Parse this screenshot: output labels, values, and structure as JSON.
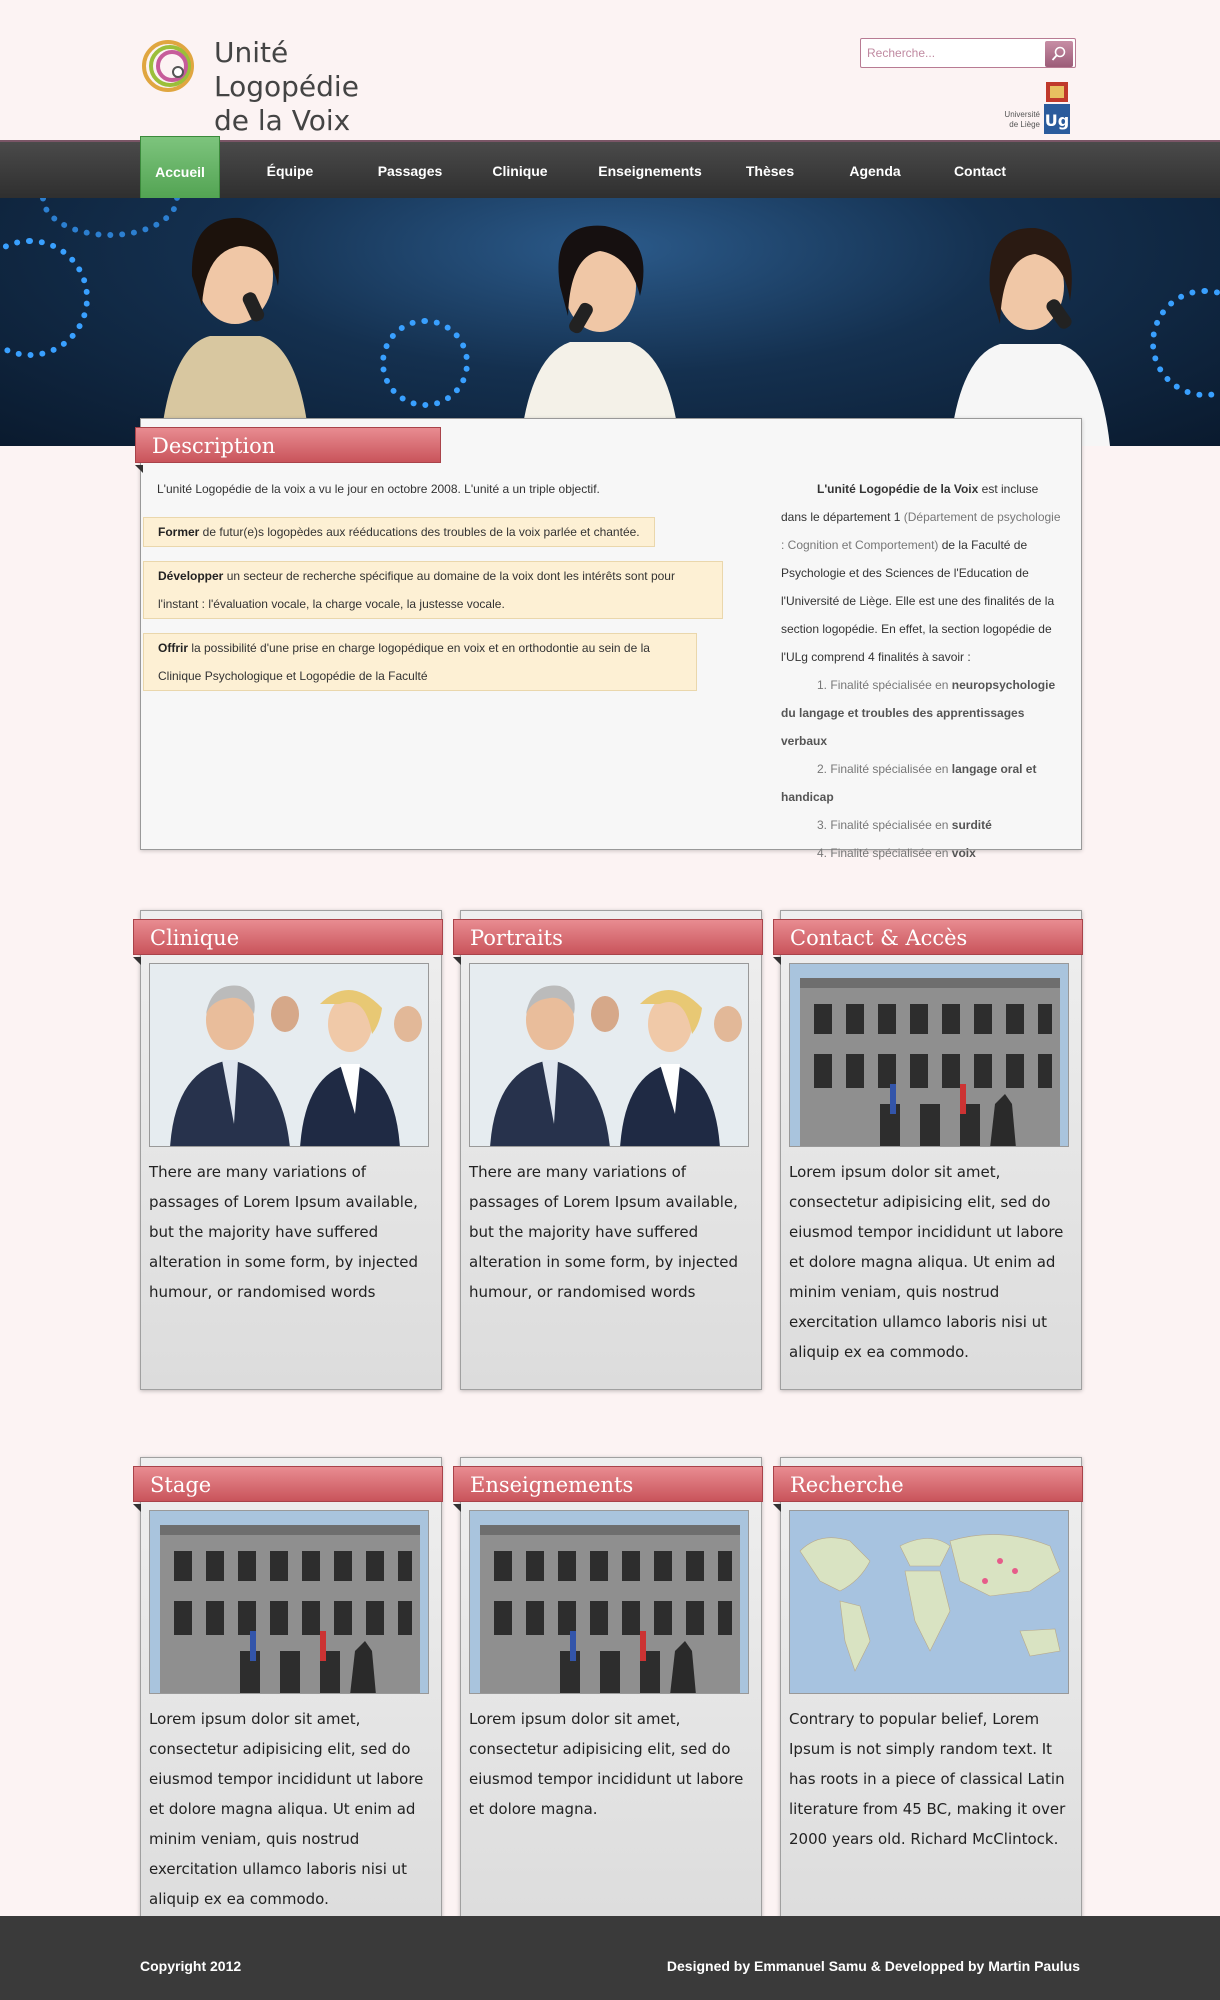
{
  "header": {
    "logo_line1": "Unité Logopédie",
    "logo_line2": "de la Voix",
    "search_placeholder": "Recherche...",
    "ulg_line1": "Université",
    "ulg_line2": "de Liège",
    "ulg_mark": "Ulg"
  },
  "nav": {
    "items": [
      "Accueil",
      "Équipe",
      "Passages",
      "Clinique",
      "Enseignements",
      "Thèses",
      "Agenda",
      "Contact"
    ],
    "active": "Accueil"
  },
  "description": {
    "title": "Description",
    "intro": "L'unité Logopédie de la voix a vu le jour en octobre 2008. L'unité a un triple objectif.",
    "objectives": [
      {
        "bold": "Former",
        "text": " de futur(e)s logopèdes aux rééducations des troubles de la voix parlée et chantée."
      },
      {
        "bold": "Développer",
        "text": " un secteur de recherche spécifique au domaine de la voix dont les intérêts sont pour l'instant : l'évaluation vocale, la charge vocale, la justesse vocale."
      },
      {
        "bold": "Offrir",
        "text": " la possibilité d'une prise en charge logopédique en voix et en orthodontie au sein de la Clinique Psychologique et Logopédie de la Faculté"
      }
    ],
    "side": {
      "bold_lead": "L'unité Logopédie de la Voix",
      "text1": " est incluse dans le département 1 ",
      "muted": "(Département de psychologie : Cognition et Comportement)",
      "text2": " de la Faculté de Psychologie et des Sciences de l'Education de l'Université de Liège. Elle est une des finalités de la section logopédie. En effet, la section logopédie de l'ULg comprend 4 finalités à savoir :",
      "list": [
        {
          "num": "1.",
          "pre": "Finalité spécialisée en ",
          "bold": "neuropsychologie du langage et troubles des apprentissages verbaux"
        },
        {
          "num": "2.",
          "pre": "Finalité spécialisée en ",
          "bold": "langage oral et handicap"
        },
        {
          "num": "3.",
          "pre": "Finalité spécialisée en ",
          "bold": "surdité"
        },
        {
          "num": "4.",
          "pre": "Finalité spécialisée en ",
          "bold": "voix"
        }
      ]
    }
  },
  "cards": [
    {
      "title": "Clinique",
      "image": "business-people",
      "text": "There are many variations of passages of Lorem Ipsum available, but the majority have suffered alteration in some form, by injected humour, or randomised words"
    },
    {
      "title": "Portraits",
      "image": "business-people",
      "text": "There are many variations of passages of Lorem Ipsum available, but the majority have suffered alteration in some form, by injected humour, or randomised words"
    },
    {
      "title": "Contact & Accès",
      "image": "university-building",
      "text": "Lorem ipsum dolor sit amet, consectetur adipisicing elit, sed do eiusmod tempor incididunt ut labore et dolore magna aliqua. Ut enim ad minim veniam, quis nostrud exercitation ullamco laboris nisi ut aliquip ex ea commodo."
    },
    {
      "title": "Stage",
      "image": "university-building",
      "text": "Lorem ipsum dolor sit amet, consectetur adipisicing elit, sed do eiusmod tempor incididunt ut labore et dolore magna aliqua. Ut enim ad minim veniam, quis nostrud exercitation ullamco laboris nisi ut aliquip ex ea commodo."
    },
    {
      "title": "Enseignements",
      "image": "university-building",
      "text": "Lorem ipsum dolor sit amet, consectetur adipisicing elit, sed do eiusmod tempor incididunt ut labore et dolore magna."
    },
    {
      "title": "Recherche",
      "image": "world-map",
      "text": "Contrary to popular belief, Lorem Ipsum is not simply random text. It has roots in a piece of classical Latin literature from 45 BC, making it over 2000 years old. Richard McClintock."
    }
  ],
  "footer": {
    "copyright": "Copyright 2012",
    "credits": "Designed by Emmanuel Samu & Developped by Martin Paulus"
  },
  "colors": {
    "ribbon": "#d9666c",
    "nav_active": "#5fae5f",
    "nav_bg": "#3a3a3a",
    "page_bg": "#fcf3f3"
  }
}
